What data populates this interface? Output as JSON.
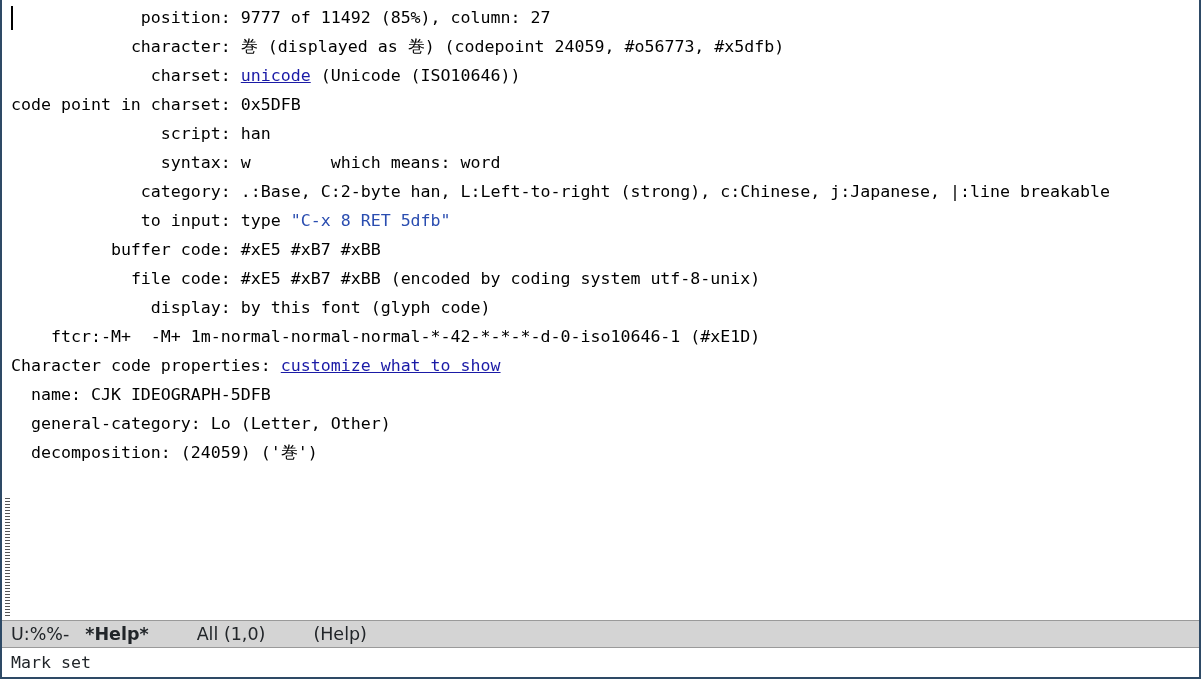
{
  "fields": [
    {
      "label": "position:",
      "parts": [
        {
          "kind": "text",
          "text": "9777 of 11492 (85%), column: 27"
        }
      ]
    },
    {
      "label": "character:",
      "parts": [
        {
          "kind": "text",
          "text": "巻 (displayed as 巻) (codepoint 24059, #o56773, #x5dfb)"
        }
      ]
    },
    {
      "label": "charset:",
      "parts": [
        {
          "kind": "link",
          "text": "unicode"
        },
        {
          "kind": "text",
          "text": " (Unicode (ISO10646))"
        }
      ]
    },
    {
      "label": "code point in charset:",
      "parts": [
        {
          "kind": "text",
          "text": "0x5DFB"
        }
      ]
    },
    {
      "label": "script:",
      "parts": [
        {
          "kind": "text",
          "text": "han"
        }
      ]
    },
    {
      "label": "syntax:",
      "parts": [
        {
          "kind": "text",
          "text": "w        which means: word"
        }
      ]
    },
    {
      "label": "category:",
      "parts": [
        {
          "kind": "text",
          "text": ".:Base, C:2-byte han, L:Left-to-right (strong), c:Chinese, j:Japanese, |:line breakable"
        }
      ]
    },
    {
      "label": "to input:",
      "parts": [
        {
          "kind": "text",
          "text": "type "
        },
        {
          "kind": "string",
          "text": "\"C-x 8 RET 5dfb\""
        }
      ]
    },
    {
      "label": "buffer code:",
      "parts": [
        {
          "kind": "text",
          "text": "#xE5 #xB7 #xBB"
        }
      ]
    },
    {
      "label": "file code:",
      "parts": [
        {
          "kind": "text",
          "text": "#xE5 #xB7 #xBB (encoded by coding system utf-8-unix)"
        }
      ]
    },
    {
      "label": "display:",
      "parts": [
        {
          "kind": "text",
          "text": "by this font (glyph code)"
        }
      ]
    }
  ],
  "font_line": "ftcr:-M+  -M+ 1m-normal-normal-normal-*-42-*-*-*-d-0-iso10646-1 (#xE1D)",
  "properties": {
    "title": "Character code properties:",
    "link": "customize what to show",
    "items": [
      {
        "name": "name:",
        "value": "CJK IDEOGRAPH-5DFB"
      },
      {
        "name": "general-category:",
        "value": "Lo (Letter, Other)"
      },
      {
        "name": "decomposition:",
        "value": "(24059) ('巻')"
      }
    ]
  },
  "mode_line": {
    "status": "U:%%-",
    "buffer": "*Help*",
    "position": "All (1,0)",
    "mode": "(Help)"
  },
  "echo": "Mark set"
}
